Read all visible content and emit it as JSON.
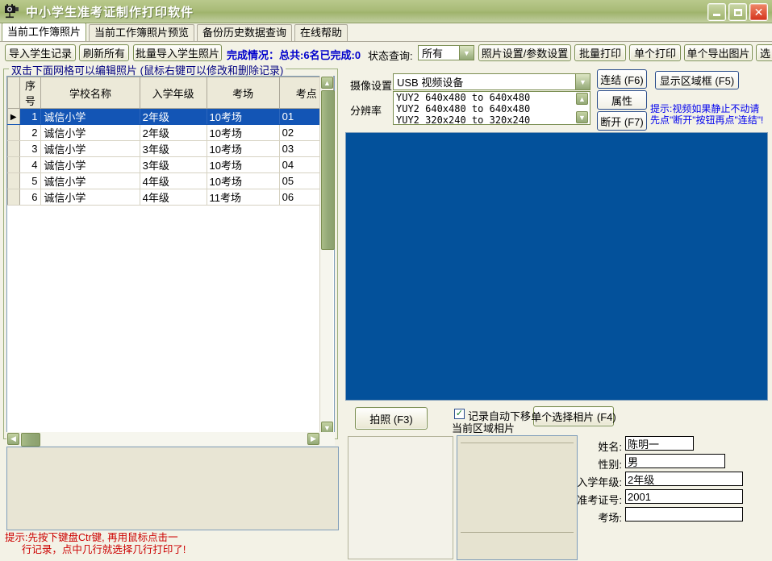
{
  "window": {
    "title": "中小学生准考证制作打印软件",
    "icon": "camera-icon",
    "minimize": "minimize-icon",
    "maximize": "maximize-icon",
    "close": "close-icon",
    "titlebar_color": "#A9BB78"
  },
  "tabs": [
    {
      "label": "当前工作簿照片",
      "active": true
    },
    {
      "label": "当前工作簿照片预览",
      "active": false
    },
    {
      "label": "备份历史数据查询",
      "active": false
    },
    {
      "label": "在线帮助",
      "active": false
    }
  ],
  "toolbar": {
    "import_records": "导入学生记录",
    "refresh_all": "刷新所有",
    "batch_import_photos": "批量导入学生照片",
    "completion_status": "完成情况：总共:6名已完成:0",
    "status_query_label": "状态查询:",
    "status_query_value": "所有",
    "status_query_options": [
      "所有"
    ],
    "photo_settings": "照片设置/参数设置",
    "batch_print": "批量打印",
    "single_print": "单个打印",
    "single_export": "单个导出图片",
    "select_button": "选"
  },
  "grid_group": {
    "legend": "双击下面网格可以编辑照片 (鼠标右键可以修改和删除记录)"
  },
  "table": {
    "columns": [
      "序号",
      "学校名称",
      "入学年级",
      "考场",
      "考点"
    ],
    "rows": [
      {
        "selected": true,
        "marker": "▶",
        "cells": [
          "1",
          "诚信小学",
          "2年级",
          "10考场",
          "01"
        ]
      },
      {
        "selected": false,
        "marker": "",
        "cells": [
          "2",
          "诚信小学",
          "2年级",
          "10考场",
          "02"
        ]
      },
      {
        "selected": false,
        "marker": "",
        "cells": [
          "3",
          "诚信小学",
          "3年级",
          "10考场",
          "03"
        ]
      },
      {
        "selected": false,
        "marker": "",
        "cells": [
          "4",
          "诚信小学",
          "3年级",
          "10考场",
          "04"
        ]
      },
      {
        "selected": false,
        "marker": "",
        "cells": [
          "5",
          "诚信小学",
          "4年级",
          "10考场",
          "05"
        ]
      },
      {
        "selected": false,
        "marker": "",
        "cells": [
          "6",
          "诚信小学",
          "4年级",
          "11考场",
          "06"
        ]
      }
    ]
  },
  "bottom_hint": "提示:先按下键盘Ctr键, 再用鼠标点击一\n      行记录，点中几行就选择几行打印了!",
  "camera": {
    "device_label": "摄像设置",
    "device_value": "USB 视频设备",
    "resolution_label": "分辨率",
    "resolutions": [
      "YUY2 640x480 to 640x480",
      "YUY2 640x480 to 640x480",
      "YUY2 320x240 to 320x240"
    ],
    "connect": "连结 (F6)",
    "properties": "属性",
    "disconnect": "断开 (F7)",
    "show_region": "显示区域框 (F5)",
    "tip_line1": "提示:视频如果静止不动请",
    "tip_line2": "先点\"断开\"按钮再点\"连结\"!",
    "video_color": "#03519B"
  },
  "capture": {
    "take_photo": "拍照 (F3)",
    "auto_advance_checked": true,
    "auto_advance_line1": "记录自动下移",
    "auto_advance_line2": "当前区域相片",
    "select_single_photo": "单个选择相片 (F4)"
  },
  "student_form": {
    "fields": [
      {
        "label": "姓名:",
        "value": "陈明一"
      },
      {
        "label": "性别:",
        "value": "男"
      },
      {
        "label": "入学年级:",
        "value": "2年级"
      },
      {
        "label": "准考证号:",
        "value": "2001"
      },
      {
        "label": "考场:",
        "value": ""
      }
    ]
  },
  "scroll": {
    "up_icon": "chevron-up-icon",
    "down_icon": "chevron-down-icon",
    "left_icon": "chevron-left-icon",
    "right_icon": "chevron-right-icon"
  }
}
